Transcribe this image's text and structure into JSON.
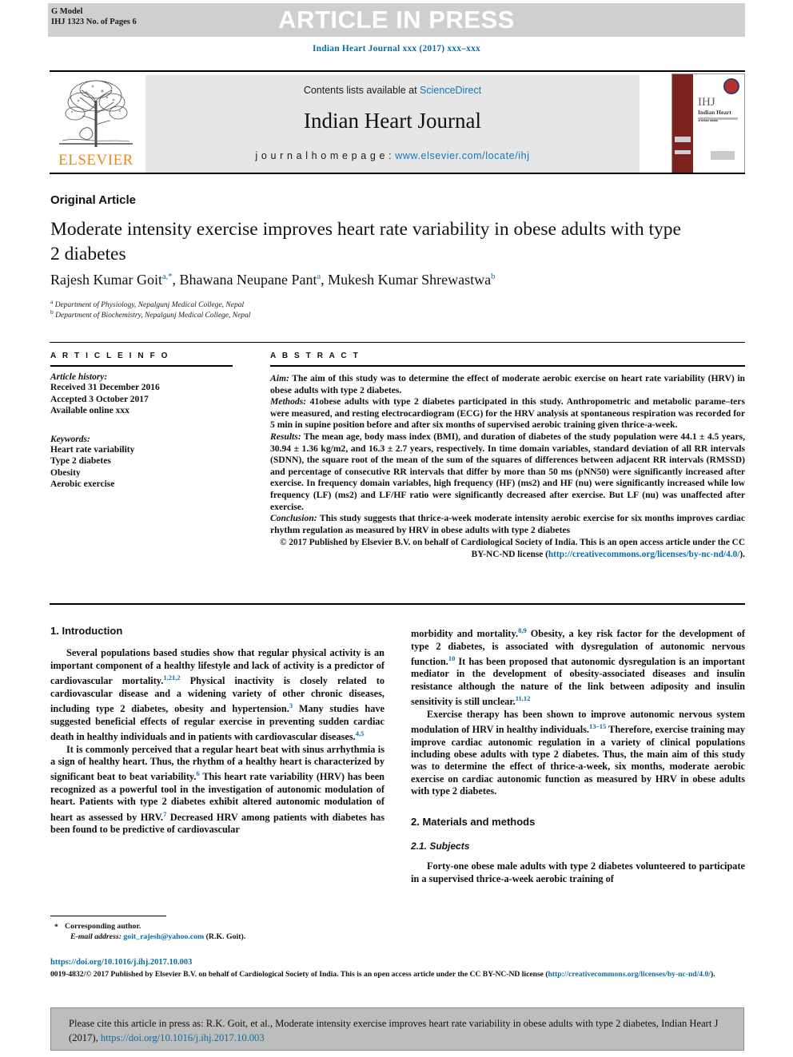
{
  "header": {
    "g_model": "G Model",
    "ihj_pages": "IHJ 1323 No. of Pages 6",
    "press_banner": "ARTICLE IN PRESS",
    "running_head": "Indian Heart Journal xxx (2017) xxx–xxx"
  },
  "masthead": {
    "contents_prefix": "Contents lists available at ",
    "sciencedirect": "ScienceDirect",
    "journal_title": "Indian Heart Journal",
    "homepage_label": "j o u r n a l  h o m e p a g e :  ",
    "homepage_url": "www.elsevier.com/locate/ihj",
    "elsevier_wordmark": "ELSEVIER",
    "cover_abbrev": "IHJ",
    "cover_title": "Indian Heart Journal"
  },
  "article": {
    "type": "Original Article",
    "title": "Moderate intensity exercise improves heart rate variability in obese adults with type 2 diabetes",
    "authors_html": "Rajesh Kumar Goit<sup>a,*</sup>, Bhawana Neupane Pant<sup>a</sup>, Mukesh Kumar Shrewastwa<sup>b</sup>",
    "affiliation_a": "Department of Physiology, Nepalgunj Medical College, Nepal",
    "affiliation_b": "Department of Biochemistry, Nepalgunj Medical College, Nepal"
  },
  "article_info": {
    "heading": "A R T I C L E  I N F O",
    "history_label": "Article history:",
    "history": [
      "Received 31 December 2016",
      "Accepted 3 October 2017",
      "Available online xxx"
    ],
    "keywords_label": "Keywords:",
    "keywords": [
      "Heart rate variability",
      "Type 2 diabetes",
      "Obesity",
      "Aerobic exercise"
    ]
  },
  "abstract": {
    "heading": "A B S T R A C T",
    "aim_label": "Aim:",
    "aim_text": " The aim of this study was to determine the effect of moderate aerobic exercise on heart rate variability (HRV) in obese adults with type 2 diabetes.",
    "methods_label": "Methods:",
    "methods_text": " 41obese adults with type 2 diabetes participated in this study. Anthropometric and metabolic parame–ters were measured, and resting electrocardiogram (ECG) for the HRV analysis at spontaneous respiration was recorded for 5 min in supine position before and after six months of supervised aerobic training given thrice-a-week.",
    "results_label": "Results:",
    "results_text": " The mean age, body mass index (BMI), and duration of diabetes of the study population were 44.1 ± 4.5 years, 30.94 ± 1.36 kg/m2, and 16.3 ± 2.7 years, respectively. In time domain variables, standard deviation of all RR intervals (SDNN), the square root of the mean of the sum of the squares of differences between adjacent RR intervals (RMSSD) and percentage of consecutive RR intervals that differ by more than 50 ms (pNN50) were significantly increased after exercise. In frequency domain variables, high frequency (HF) (ms2) and HF (nu) were significantly increased while low frequency (LF) (ms2) and LF/HF ratio were significantly decreased after exercise. But LF (nu) was unaffected after exercise.",
    "conclusion_label": "Conclusion:",
    "conclusion_text": " This study suggests that thrice-a-week moderate intensity aerobic exercise for six months improves cardiac rhythm regulation as measured by HRV in obese adults with type 2 diabetes",
    "copyright_text": "© 2017 Published by Elsevier B.V. on behalf of Cardiological Society of India. This is an open access article under the CC BY-NC-ND license (",
    "copyright_link": "http://creativecommons.org/licenses/by-nc-nd/4.0/",
    "copyright_tail": ")."
  },
  "body": {
    "intro_heading": "1. Introduction",
    "intro_p1_html": "Several populations based studies show that regular physical activity is an important component of a healthy lifestyle and lack of activity is a predictor of cardiovascular mortality.<sup>1,21,2</sup> Physical inactivity is closely related to cardiovascular disease and a widening variety of other chronic diseases, including type 2 diabetes, obesity and hypertension.<sup>3</sup> Many studies have suggested beneficial effects of regular exercise in preventing sudden cardiac death in healthy individuals and in patients with cardiovascular diseases.<sup>4,5</sup>",
    "intro_p2_html": "It is commonly perceived that a regular heart beat with sinus arrhythmia is a sign of healthy heart. Thus, the rhythm of a healthy heart is characterized by significant beat to beat variability.<sup>6</sup> This heart rate variability (HRV) has been recognized as a powerful tool in the investigation of autonomic modulation of heart. Patients with type 2 diabetes exhibit altered autonomic modulation of heart as assessed by HRV.<sup>7</sup> Decreased HRV among patients with diabetes has been found to be predictive of cardiovascular",
    "intro_p3_html": "morbidity and mortality.<sup>8,9</sup> Obesity, a key risk factor for the development of type 2 diabetes, is associated with dysregulation of autonomic nervous function.<sup>10</sup> It has been proposed that autonomic dysregulation is an important mediator in the development of obesity-associated diseases and insulin resistance although the nature of the link between adiposity and insulin sensitivity is still unclear.<sup>11,12</sup>",
    "intro_p4_html": "Exercise therapy has been shown to improve autonomic nervous system modulation of HRV in healthy individuals.<sup>13–15</sup> Therefore, exercise training may improve cardiac autonomic regulation in a variety of clinical populations including obese adults with type 2 diabetes. Thus, the main aim of this study was to determine the effect of thrice-a-week, six months, moderate aerobic exercise on cardiac autonomic function as measured by HRV in obese adults with type 2 diabetes.",
    "methods_heading": "2. Materials and methods",
    "subjects_heading": "2.1. Subjects",
    "subjects_p1_html": "Forty-one obese male adults with type 2 diabetes volunteered to participate in a supervised thrice-a-week aerobic training of"
  },
  "footer": {
    "corresponding_star": "*",
    "corresponding_author": "Corresponding author.",
    "email_label": "E-mail address:",
    "email": "goit_rajesh@yahoo.com",
    "email_suffix": " (R.K. Goit).",
    "doi": "https://doi.org/10.1016/j.ihj.2017.10.003",
    "issn_text": "0019-4832/© 2017 Published by Elsevier B.V. on behalf of Cardiological Society of India. This is an open access article under the CC BY-NC-ND license (",
    "issn_link": "http://creativecommons.org/licenses/by-nc-nd/4.0/",
    "issn_tail": ").",
    "citation_prefix": "Please cite this article in press as: R.K. Goit, et al., Moderate intensity exercise improves heart rate variability in obese adults with type 2 diabetes, Indian Heart J (2017), ",
    "citation_doi": "https://doi.org/10.1016/j.ihj.2017.10.003"
  },
  "colors": {
    "link": "#0b6ca3",
    "elsevier_orange": "#eb8a23",
    "band_grey": "#cfcfcf",
    "masthead_grey": "#e6e6e6",
    "cover_maroon": "#7d231f",
    "cite_box": "#bdbdbd"
  }
}
